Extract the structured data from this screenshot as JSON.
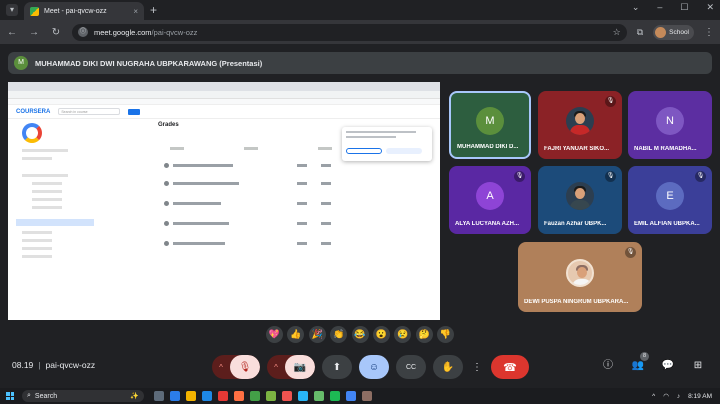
{
  "browser": {
    "tab_title": "Meet - pai-qvcw-ozz",
    "tab_close": "×",
    "new_tab": "+",
    "url_host": "meet.google.com",
    "url_path": "/pai-qvcw-ozz",
    "profile_label": "School",
    "window_controls": [
      "⌄",
      "–",
      "☐",
      "✕"
    ]
  },
  "presenter": {
    "initial": "M",
    "name": "MUHAMMAD DIKI DWI NUGRAHA UBPKARAWANG (Presentasi)"
  },
  "shared_screen": {
    "logo": "COURSERA",
    "search_placeholder": "Search in course",
    "heading": "Grades"
  },
  "participants": [
    {
      "initial": "M",
      "name": "MUHAMMAD DIKI D...",
      "bg": "#2d5e3f",
      "avatar_bg": "#5b8f3c"
    },
    {
      "name": "FAJRI YANUAR SIKO...",
      "bg": "#8b2226"
    },
    {
      "initial": "N",
      "name": "NABIL M RAMADHA...",
      "bg": "#5c2ea1",
      "avatar_bg": "#7e57c2"
    },
    {
      "initial": "A",
      "name": "ALYA LUCYANA AZH...",
      "bg": "#5a28a3",
      "avatar_bg": "#8e44d6"
    },
    {
      "name": "Fauzan Azhar UBPK...",
      "bg": "#1c4b7a"
    },
    {
      "initial": "E",
      "name": "EMIL ALFIAN UBPKA...",
      "bg": "#3b3f99",
      "avatar_bg": "#5c6bc0"
    },
    {
      "name": "DEWI PUSPA NINGRUM UBPKARA...",
      "bg": "#b0805a"
    }
  ],
  "reactions": [
    "💖",
    "👍",
    "🎉",
    "👏",
    "😂",
    "😮",
    "😢",
    "🤔",
    "👎"
  ],
  "meeting": {
    "time": "08.19",
    "separator": "|",
    "code": "pai-qvcw-ozz"
  },
  "controls": {
    "mic": "🎙",
    "camera": "📷",
    "caret": "^",
    "captions": "CC",
    "emoji": "☺",
    "present": "⬆",
    "raise_hand": "✋",
    "more": "⋮",
    "leave": "☎"
  },
  "right_controls": {
    "people_count": "8"
  },
  "taskbar": {
    "search_label": "Search",
    "clock": "8:19 AM"
  },
  "colors": {
    "meet_bg": "#202124",
    "leave_red": "#dc362e",
    "active_tile_border": "#a8c7fa"
  }
}
